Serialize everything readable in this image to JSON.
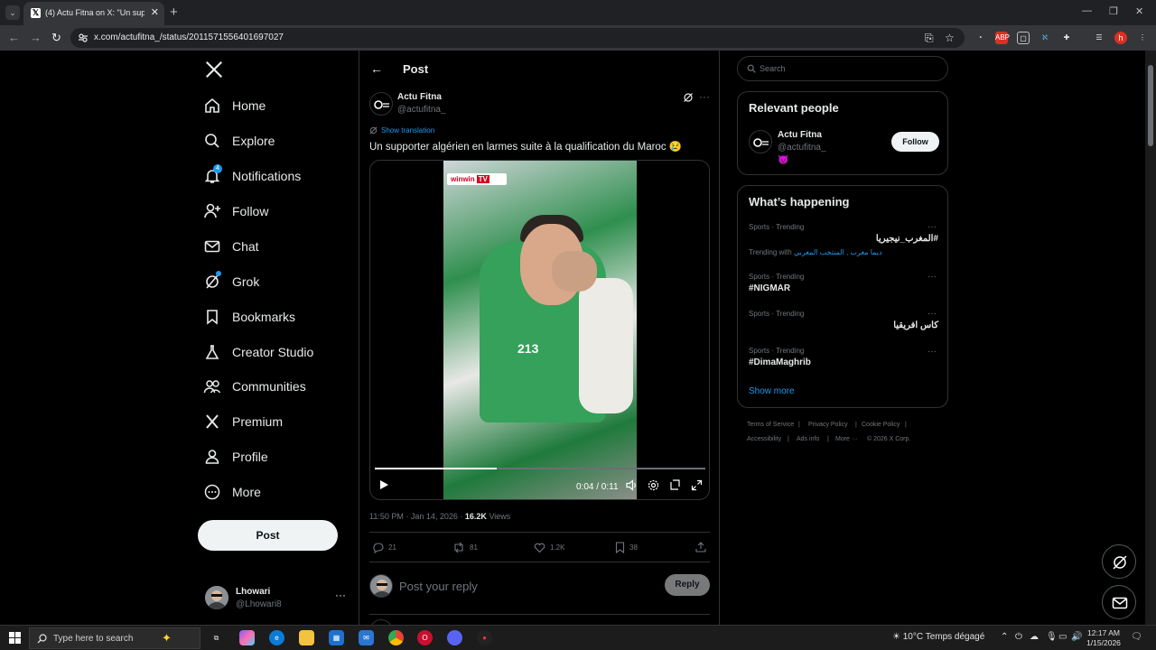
{
  "browser": {
    "tab_title": "(4) Actu Fitna on X: \"Un support",
    "url": "x.com/actufitna_/status/2011571556401697027"
  },
  "nav": {
    "items": [
      {
        "label": "Home",
        "icon": "home-icon"
      },
      {
        "label": "Explore",
        "icon": "search-icon"
      },
      {
        "label": "Notifications",
        "icon": "bell-icon",
        "badge": "4"
      },
      {
        "label": "Follow",
        "icon": "person-plus-icon"
      },
      {
        "label": "Chat",
        "icon": "mail-icon"
      },
      {
        "label": "Grok",
        "icon": "grok-icon"
      },
      {
        "label": "Bookmarks",
        "icon": "bookmark-icon"
      },
      {
        "label": "Creator Studio",
        "icon": "flask-icon"
      },
      {
        "label": "Communities",
        "icon": "people-icon"
      },
      {
        "label": "Premium",
        "icon": "x-icon"
      },
      {
        "label": "Profile",
        "icon": "person-icon"
      },
      {
        "label": "More",
        "icon": "more-circle-icon"
      }
    ],
    "post_button": "Post"
  },
  "me": {
    "name": "Lhowari",
    "handle": "@Lhowari8"
  },
  "header": {
    "title": "Post"
  },
  "post": {
    "author_name": "Actu Fitna",
    "author_handle": "@actufitna_",
    "show_translation": "Show translation",
    "text": "Un supporter algérien en larmes suite à la qualification du Maroc 😢",
    "video": {
      "brand": "winwin",
      "brand_tag": "TV",
      "jersey_number": "213",
      "time": "0:04 / 0:11",
      "progress": 0.37
    },
    "time": "11:50 PM · Jan 14, 2026 · ",
    "views": "16.2K",
    "views_label": " Views",
    "replies": "21",
    "reposts": "81",
    "likes": "1.2K",
    "bookmarks": "38"
  },
  "reply": {
    "placeholder": "Post your reply",
    "button": "Reply"
  },
  "search": {
    "placeholder": "Search"
  },
  "relevant": {
    "title": "Relevant people",
    "name": "Actu Fitna",
    "handle": "@actufitna_",
    "emoji": "😈",
    "follow": "Follow"
  },
  "happening": {
    "title": "What’s happening",
    "trends": [
      {
        "category": "Sports · Trending",
        "name": "#المغرب_نيجيريا",
        "with_label": "Trending with ",
        "with": "ديما مغرب , المنتخب المغربي",
        "rtl": true
      },
      {
        "category": "Sports · Trending",
        "name": "#NIGMAR",
        "rtl": false
      },
      {
        "category": "Sports · Trending",
        "name": "كاس افريقيا",
        "rtl": true
      },
      {
        "category": "Sports · Trending",
        "name": "#DimaMaghrib",
        "rtl": false
      }
    ],
    "show_more": "Show more"
  },
  "footer": [
    "Terms of Service",
    "|",
    "Privacy Policy",
    "|",
    "Cookie Policy",
    "|",
    "Accessibility",
    "|",
    "Ads info",
    "|",
    "More ···",
    "© 2026 X Corp."
  ],
  "taskbar": {
    "search_placeholder": "Type here to search",
    "temp": "10°C",
    "weather": "Temps dégagé",
    "time": "12:17 AM",
    "date": "1/15/2026"
  }
}
